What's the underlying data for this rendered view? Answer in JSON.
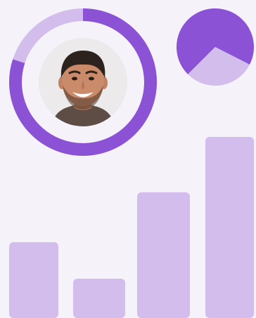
{
  "colors": {
    "background": "#f5f2fa",
    "accent": "#8c52d6",
    "accent_light": "#d3bdec",
    "avatar_bg": "#eceaea"
  },
  "progress_ring": {
    "progress": 0.8,
    "icon": "avatar-photo"
  },
  "pie": {
    "slices": [
      0.7,
      0.3
    ]
  },
  "bars": {
    "values": [
      100,
      48,
      171,
      250
    ]
  }
}
